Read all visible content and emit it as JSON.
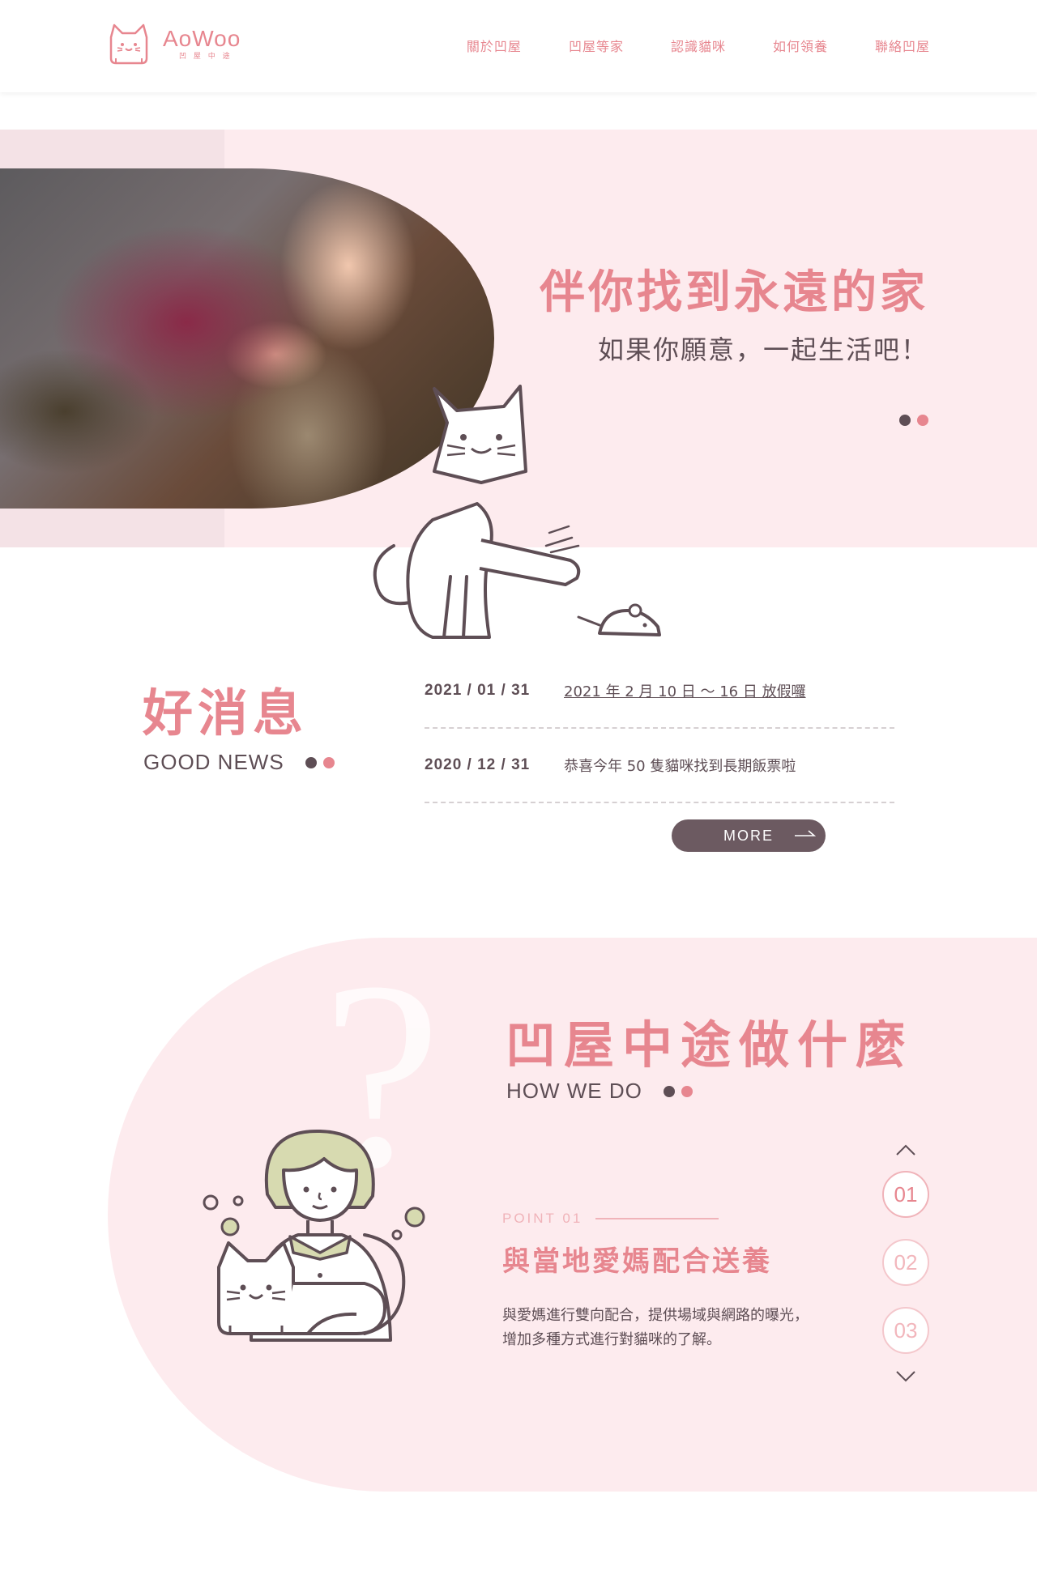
{
  "header": {
    "logo_name": "AoWoo",
    "logo_sub": "凹 屋 中 途",
    "nav": [
      "關於凹屋",
      "凹屋等家",
      "認識貓咪",
      "如何領養",
      "聯絡凹屋"
    ]
  },
  "hero": {
    "title": "伴你找到永遠的家",
    "subtitle": "如果你願意，一起生活吧！"
  },
  "news": {
    "title": "好消息",
    "subtitle": "GOOD NEWS",
    "items": [
      {
        "date": "2021 / 01 / 31",
        "text": "2021 年 2 月 10 日 ～ 16 日 放假囉"
      },
      {
        "date": "2020 / 12 / 31",
        "text": "恭喜今年 50 隻貓咪找到長期飯票啦"
      }
    ],
    "more_label": "MORE"
  },
  "how": {
    "title": "凹屋中途做什麼",
    "subtitle": "HOW WE DO",
    "point_label": "POINT 01",
    "point_title": "與當地愛媽配合送養",
    "point_desc_1": "與愛媽進行雙向配合，提供場域與網路的曝光，",
    "point_desc_2": "增加多種方式進行對貓咪的了解。",
    "pages": [
      "01",
      "02",
      "03"
    ]
  },
  "colors": {
    "accent_pink": "#e7868f",
    "dark": "#5e4e55",
    "bg_pink": "#fdebee"
  },
  "icons": [
    "cat-logo-icon",
    "arrow-right-icon",
    "chevron-up-icon",
    "chevron-down-icon"
  ]
}
